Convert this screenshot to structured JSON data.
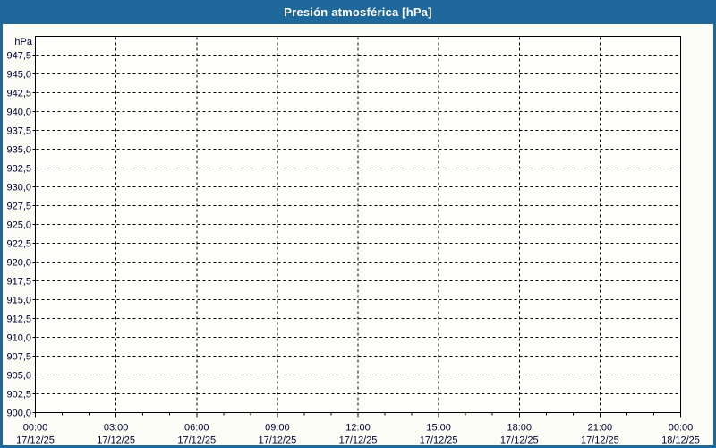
{
  "window": {
    "title": "Presión atmosférica [hPa]"
  },
  "colors": {
    "titlebar_bg": "#1e689b",
    "titlebar_text": "#ffffff",
    "frame_border": "#1e689b",
    "plot_bg": "#fefefa",
    "page_bg": "#fbfcf6",
    "axis_and_grid": "#000000",
    "tick_label_text": "#000033"
  },
  "chart_data": {
    "type": "line",
    "title": "Presión atmosférica [hPa]",
    "ylabel_unit": "hPa",
    "ylim": [
      900,
      950
    ],
    "ytick_step": 2.5,
    "grid": "dashed",
    "legend": "none",
    "series": [],
    "yticks": [
      {
        "value": 947.5,
        "label": "947,5"
      },
      {
        "value": 945.0,
        "label": "945,0"
      },
      {
        "value": 942.5,
        "label": "942,5"
      },
      {
        "value": 940.0,
        "label": "940,0"
      },
      {
        "value": 937.5,
        "label": "937,5"
      },
      {
        "value": 935.0,
        "label": "935,0"
      },
      {
        "value": 932.5,
        "label": "932,5"
      },
      {
        "value": 930.0,
        "label": "930,0"
      },
      {
        "value": 927.5,
        "label": "927,5"
      },
      {
        "value": 925.0,
        "label": "925,0"
      },
      {
        "value": 922.5,
        "label": "922,5"
      },
      {
        "value": 920.0,
        "label": "920,0"
      },
      {
        "value": 917.5,
        "label": "917,5"
      },
      {
        "value": 915.0,
        "label": "915,0"
      },
      {
        "value": 912.5,
        "label": "912,5"
      },
      {
        "value": 910.0,
        "label": "910,0"
      },
      {
        "value": 907.5,
        "label": "907,5"
      },
      {
        "value": 905.0,
        "label": "905,0"
      },
      {
        "value": 902.5,
        "label": "902,5"
      },
      {
        "value": 900.0,
        "label": "900,0"
      }
    ],
    "xticks": [
      {
        "time": "00:00",
        "date": "17/12/25"
      },
      {
        "time": "03:00",
        "date": "17/12/25"
      },
      {
        "time": "06:00",
        "date": "17/12/25"
      },
      {
        "time": "09:00",
        "date": "17/12/25"
      },
      {
        "time": "12:00",
        "date": "17/12/25"
      },
      {
        "time": "15:00",
        "date": "17/12/25"
      },
      {
        "time": "18:00",
        "date": "17/12/25"
      },
      {
        "time": "21:00",
        "date": "17/12/25"
      },
      {
        "time": "00:00",
        "date": "18/12/25"
      }
    ],
    "x_minor_ticks_per_major": 3
  }
}
